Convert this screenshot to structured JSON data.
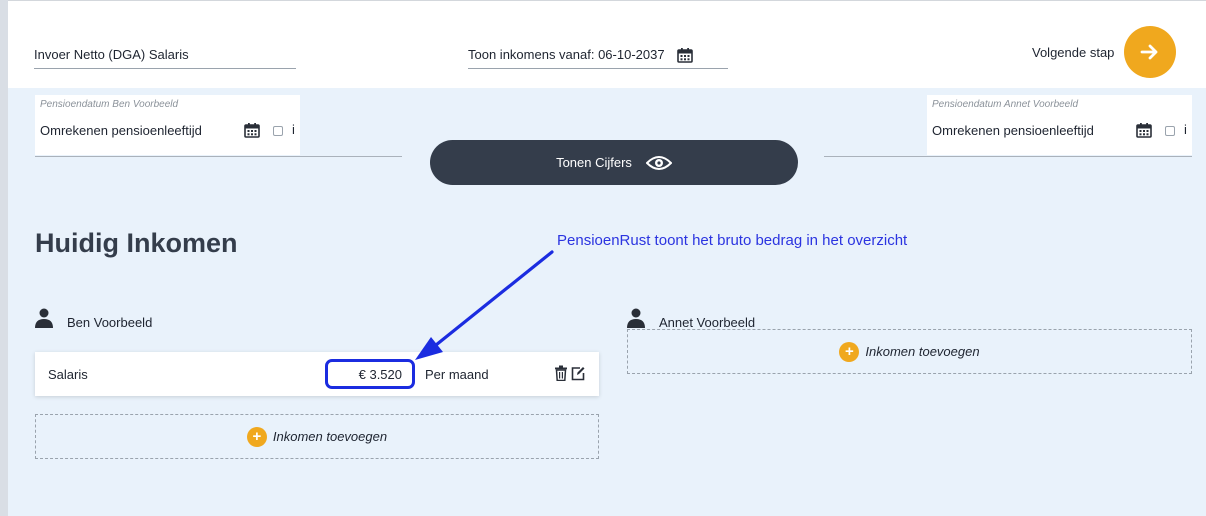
{
  "header": {
    "salary_field": "Invoer Netto (DGA) Salaris",
    "toon_field": "Toon inkomens vanaf: 06-10-2037",
    "next_label": "Volgende stap"
  },
  "pension_left": {
    "label": "Pensioendatum Ben Voorbeeld",
    "value": "Omrekenen pensioenleeftijd",
    "info": "i"
  },
  "pension_right": {
    "label": "Pensioendatum Annet Voorbeeld",
    "value": "Omrekenen pensioenleeftijd",
    "info": "i"
  },
  "tonen_button": "Tonen Cijfers",
  "section_title": "Huidig Inkomen",
  "annotation": "PensioenRust toont het bruto bedrag in het overzicht",
  "persons": {
    "ben": "Ben Voorbeeld",
    "annet": "Annet Voorbeeld"
  },
  "income_row": {
    "label": "Salaris",
    "amount": "€ 3.520",
    "period": "Per maand"
  },
  "add_income": "Inkomen toevoegen",
  "colors": {
    "accent_orange": "#f0a81e",
    "dark_button": "#343d4b",
    "annotation_blue": "#2b34e0",
    "background": "#e9f2fb"
  }
}
